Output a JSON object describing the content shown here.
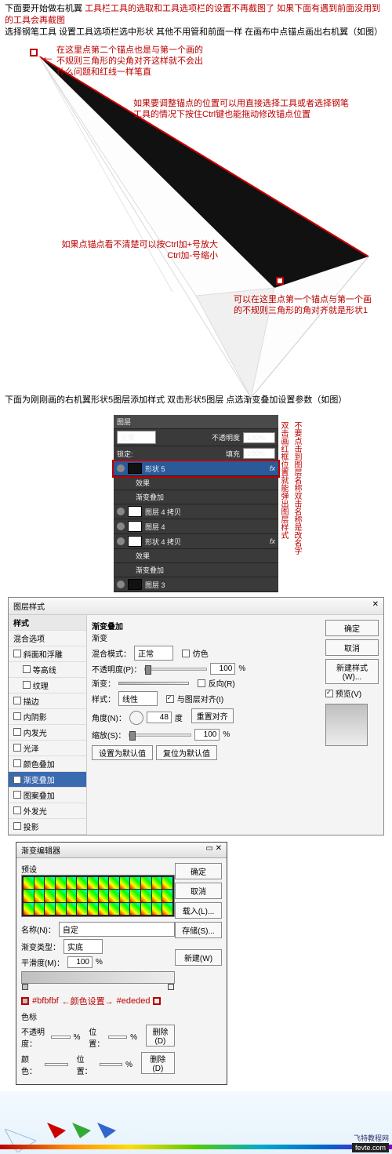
{
  "intro": {
    "l1a": "下面要开始做右机翼 ",
    "l1b": "工具栏工具的选取和工具选项栏的设置不再截图了 如果下面有遇到前面没用到的工具会再截图",
    "l2": "选择钢笔工具 设置工具选项栏选中形状 其他不用管和前面一样 在画布中点锚点画出右机翼（如图）"
  },
  "annos": {
    "a1": "在这里点第二个锚点也是与第一个画的不规则三角形的尖角对齐这样就不会出什么问题和红线一样笔直",
    "a2": "如果要调整锚点的位置可以用直接选择工具或者选择钢笔工具的情况下按住Ctrl键也能拖动修改锚点位置",
    "a3a": "如果点锚点看不清楚可以按Ctrl加+号放大",
    "a3b": "Ctrl加-号缩小",
    "a4": "可以在这里点第一个锚点与第一个画的不规则三角形的角对齐就是形状1"
  },
  "step2": "下面为刚刚画的右机翼形状5图层添加样式 双击形状5图层 点选渐变叠加设置参数（如图）",
  "layers": {
    "tab": "图层",
    "mode": "正常",
    "opacity_label": "不透明度",
    "opacity": "100%",
    "lock": "锁定:",
    "fill_label": "填充",
    "fill": "100%",
    "items": [
      {
        "name": "形状 5",
        "fx": "fx"
      },
      {
        "name": "效果",
        "sub": true
      },
      {
        "name": "渐变叠加",
        "sub": true
      },
      {
        "name": "图层 4 拷贝"
      },
      {
        "name": "图层 4"
      },
      {
        "name": "形状 4 拷贝",
        "fx": "fx"
      },
      {
        "name": "效果",
        "sub": true
      },
      {
        "name": "渐变叠加",
        "sub": true
      },
      {
        "name": "图层 3"
      }
    ],
    "side1": "双击画红框位置就能弹出图层样式",
    "side2": "不要点击到图层名称双击名称是改名字"
  },
  "lsd": {
    "title": "图层样式",
    "left": {
      "hdr": "样式",
      "blend": "混合选项",
      "items": [
        "斜面和浮雕",
        "等高线",
        "纹理",
        "描边",
        "内阴影",
        "内发光",
        "光泽",
        "颜色叠加",
        "渐变叠加",
        "图案叠加",
        "外发光",
        "投影"
      ]
    },
    "mid": {
      "section": "渐变叠加",
      "sub": "渐变",
      "blendmode_l": "混合模式：",
      "blendmode_v": "正常",
      "dither_l": "仿色",
      "opacity_l": "不透明度(P)：",
      "opacity_v": "100",
      "pct": "%",
      "grad_l": "渐变：",
      "reverse_l": "反向(R)",
      "style_l": "样式：",
      "style_v": "线性",
      "align_l": "与图层对齐(I)",
      "angle_l": "角度(N)：",
      "angle_v": "48",
      "deg": "度",
      "reset_align": "重置对齐",
      "scale_l": "缩放(S)：",
      "scale_v": "100",
      "set_default": "设置为默认值",
      "reset_default": "复位为默认值"
    },
    "right": {
      "ok": "确定",
      "cancel": "取消",
      "newstyle": "新建样式(W)...",
      "preview": "预览(V)"
    }
  },
  "ged": {
    "title": "渐变编辑器",
    "presets": "预设",
    "ok": "确定",
    "cancel": "取消",
    "load": "载入(L)...",
    "save": "存储(S)...",
    "name_l": "名称(N)：",
    "name_v": "自定",
    "new": "新建(W)",
    "type_l": "渐变类型：",
    "type_v": "实底",
    "smooth_l": "平滑度(M)：",
    "smooth_v": "100",
    "pct": "%",
    "hexL": "#bfbfbf",
    "colorset": "←颜色设置→",
    "hexR": "#ededed",
    "stops": "色标",
    "opac_l": "不透明度：",
    "pos_l": "位置：",
    "del": "删除(D)",
    "color_l": "颜色："
  },
  "footer": {
    "site": "飞特教程网",
    "logo": "fevte.com"
  }
}
